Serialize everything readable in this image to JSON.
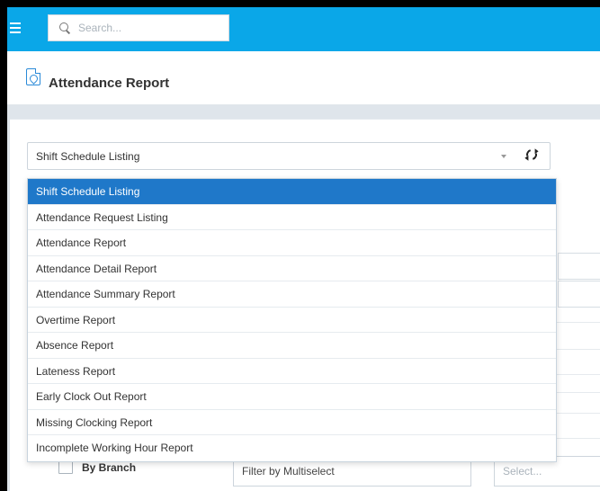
{
  "search": {
    "placeholder": "Search..."
  },
  "page": {
    "title": "Attendance Report"
  },
  "report_select": {
    "value": "Shift Schedule Listing"
  },
  "dropdown": {
    "options": [
      "Shift Schedule Listing",
      "Attendance Request Listing",
      "Attendance Report",
      "Attendance Detail Report",
      "Attendance Summary Report",
      "Overtime Report",
      "Absence Report",
      "Lateness Report",
      "Early Clock Out Report",
      "Missing Clocking Report",
      "Incomplete Working Hour Report"
    ],
    "selected_index": 0
  },
  "filters": {
    "branch_label": "By Branch",
    "multiselect_label": "Filter by Multiselect",
    "select_placeholder": "Select..."
  },
  "colors": {
    "topbar": "#0aa7e8",
    "selected_option": "#1f78c9",
    "icon_accent": "#2a8ad8"
  },
  "icons": {
    "menu": "hamburger-menu-icon",
    "search": "search-icon",
    "title": "file-pdf-icon",
    "refresh": "refresh-icon",
    "dropdown": "chevron-down-icon"
  }
}
